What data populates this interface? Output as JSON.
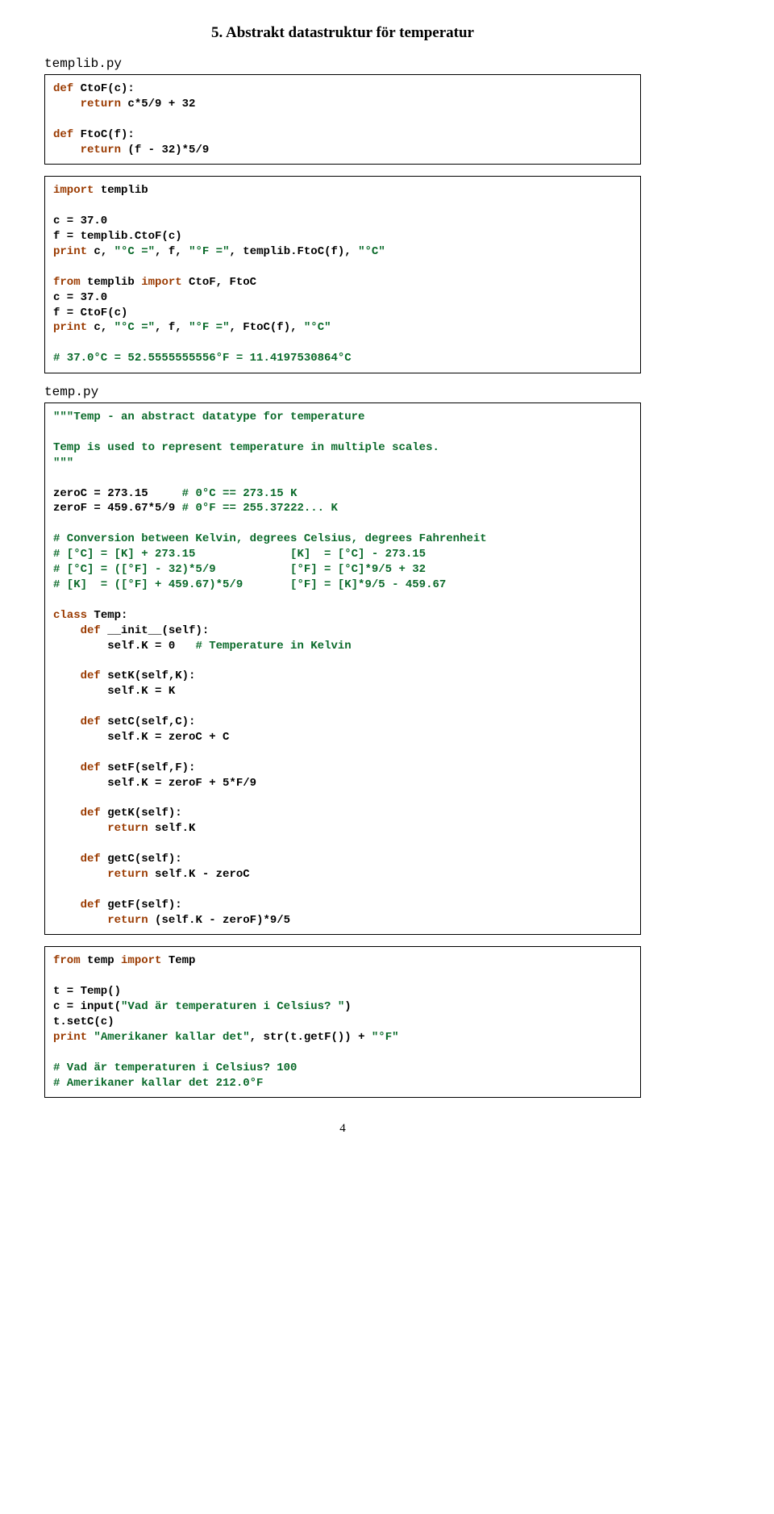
{
  "heading": "5. Abstrakt datastruktur för temperatur",
  "file1": "templib.py",
  "box1": "<span class=\"kw\">def</span> CtoF(c):\n    <span class=\"kw\">return</span> c*5/9 + 32\n\n<span class=\"kw\">def</span> FtoC(f):\n    <span class=\"kw\">return</span> (f - 32)*5/9",
  "box2": "<span class=\"kw\">import</span> templib\n\nc = 37.0\nf = templib.CtoF(c)\n<span class=\"kw\">print</span> c, <span class=\"str\">\"°C =\"</span>, f, <span class=\"str\">\"°F =\"</span>, templib.FtoC(f), <span class=\"str\">\"°C\"</span>\n\n<span class=\"kw\">from</span> templib <span class=\"kw\">import</span> CtoF, FtoC\nc = 37.0\nf = CtoF(c)\n<span class=\"kw\">print</span> c, <span class=\"str\">\"°C =\"</span>, f, <span class=\"str\">\"°F =\"</span>, FtoC(f), <span class=\"str\">\"°C\"</span>\n\n<span class=\"cmt\"># 37.0°C = 52.5555555556°F = 11.4197530864°C</span>",
  "file2": "temp.py",
  "box3": "<span class=\"str\">\"\"\"Temp - an abstract datatype for temperature\n\nTemp is used to represent temperature in multiple scales.\n\"\"\"</span>\n\nzeroC = 273.15     <span class=\"cmt\"># 0°C == 273.15 K</span>\nzeroF = 459.67*5/9 <span class=\"cmt\"># 0°F == 255.37222... K</span>\n\n<span class=\"cmt\"># Conversion between Kelvin, degrees Celsius, degrees Fahrenheit</span>\n<span class=\"cmt\"># [°C] = [K] + 273.15              [K]  = [°C] - 273.15</span>\n<span class=\"cmt\"># [°C] = ([°F] - 32)*5/9           [°F] = [°C]*9/5 + 32</span>\n<span class=\"cmt\"># [K]  = ([°F] + 459.67)*5/9       [°F] = [K]*9/5 - 459.67</span>\n\n<span class=\"kw\">class</span> Temp:\n    <span class=\"kw\">def</span> __init__(self):\n        self.K = 0   <span class=\"cmt\"># Temperature in Kelvin</span>\n\n    <span class=\"kw\">def</span> setK(self,K):\n        self.K = K\n\n    <span class=\"kw\">def</span> setC(self,C):\n        self.K = zeroC + C\n\n    <span class=\"kw\">def</span> setF(self,F):\n        self.K = zeroF + 5*F/9\n\n    <span class=\"kw\">def</span> getK(self):\n        <span class=\"kw\">return</span> self.K\n\n    <span class=\"kw\">def</span> getC(self):\n        <span class=\"kw\">return</span> self.K - zeroC\n\n    <span class=\"kw\">def</span> getF(self):\n        <span class=\"kw\">return</span> (self.K - zeroF)*9/5",
  "box4": "<span class=\"kw\">from</span> temp <span class=\"kw\">import</span> Temp\n\nt = Temp()\nc = input(<span class=\"str\">\"Vad är temperaturen i Celsius? \"</span>)\nt.setC(c)\n<span class=\"kw\">print</span> <span class=\"str\">\"Amerikaner kallar det\"</span>, str(t.getF()) + <span class=\"str\">\"°F\"</span>\n\n<span class=\"cmt\"># Vad är temperaturen i Celsius? 100</span>\n<span class=\"cmt\"># Amerikaner kallar det 212.0°F</span>",
  "pageNumber": "4"
}
